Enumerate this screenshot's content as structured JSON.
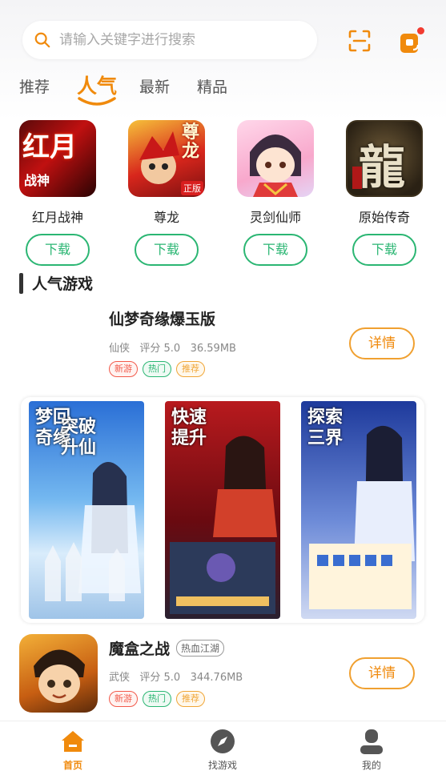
{
  "search": {
    "placeholder": "请输入关键字进行搜索"
  },
  "header": {
    "scan_icon": "scan-icon",
    "message_icon": "message-icon"
  },
  "tabs": [
    {
      "label": "推荐",
      "active": false
    },
    {
      "label": "人气",
      "active": true
    },
    {
      "label": "最新",
      "active": false
    },
    {
      "label": "精品",
      "active": false
    }
  ],
  "featured": [
    {
      "name": "红月战神",
      "icon_text": "红月",
      "icon_sub": "战神",
      "download_label": "下载"
    },
    {
      "name": "尊龙",
      "icon_text": "尊龙",
      "icon_badge": "正版",
      "download_label": "下载"
    },
    {
      "name": "灵剑仙师",
      "download_label": "下载"
    },
    {
      "name": "原始传奇",
      "icon_text": "龍",
      "download_label": "下载"
    }
  ],
  "section": {
    "title": "人气游戏"
  },
  "games": [
    {
      "title": "仙梦奇缘爆玉版",
      "meta": "仙侠   评分 5.0   36.59MB",
      "tags": [
        "新游",
        "热门",
        "推荐"
      ],
      "detail_label": "详情"
    },
    {
      "title": "魔盒之战",
      "genre": "热血江湖",
      "meta": "武侠   评分 5.0   344.76MB",
      "tags": [
        "新游",
        "热门",
        "推荐"
      ],
      "detail_label": "详情"
    }
  ],
  "banner": {
    "panels": [
      {
        "title_line1": "梦回",
        "title_line2": "奇缘",
        "title_line3": "突破",
        "title_line4": "升仙"
      },
      {
        "title_line1": "快速",
        "title_line2": "提升"
      },
      {
        "title_line1": "探索",
        "title_line2": "三界"
      }
    ]
  },
  "bottom_nav": [
    {
      "label": "首页",
      "icon": "home-icon",
      "active": true
    },
    {
      "label": "找游戏",
      "icon": "compass-icon",
      "active": false
    },
    {
      "label": "我的",
      "icon": "user-icon",
      "active": false
    }
  ],
  "colors": {
    "accent": "#f08a0c",
    "green": "#2bb673",
    "new_tag": "#f25a4b"
  }
}
